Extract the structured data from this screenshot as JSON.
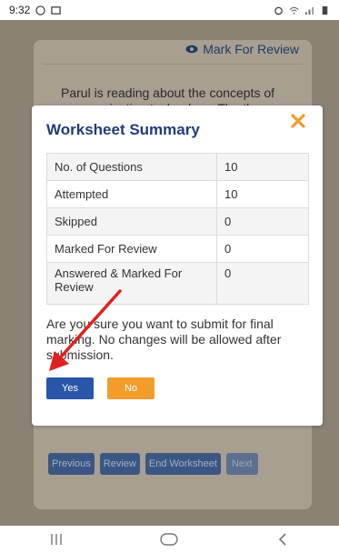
{
  "status": {
    "time": "9:32"
  },
  "background": {
    "mark_review": "Mark For Review",
    "question": "Parul is reading about the concepts of communication technology. The three components in a directly",
    "nav": [
      "Previous",
      "Review",
      "End Worksheet",
      "Next"
    ]
  },
  "modal": {
    "title": "Worksheet Summary",
    "rows": [
      {
        "label": "No. of Questions",
        "value": "10"
      },
      {
        "label": "Attempted",
        "value": "10"
      },
      {
        "label": "Skipped",
        "value": "0"
      },
      {
        "label": "Marked For Review",
        "value": "0"
      },
      {
        "label": "Answered & Marked For Review",
        "value": "0"
      }
    ],
    "confirm_text": "Are you sure you want to submit for final marking. No changes will be allowed after submission.",
    "yes_label": "Yes",
    "no_label": "No"
  },
  "colors": {
    "title": "#1f3d7a",
    "yes": "#2956a8",
    "no": "#f39c2c",
    "close": "#f39c2c",
    "arrow": "#e02020"
  },
  "icons": {
    "close": "close-x-icon",
    "eye": "eye-icon"
  }
}
